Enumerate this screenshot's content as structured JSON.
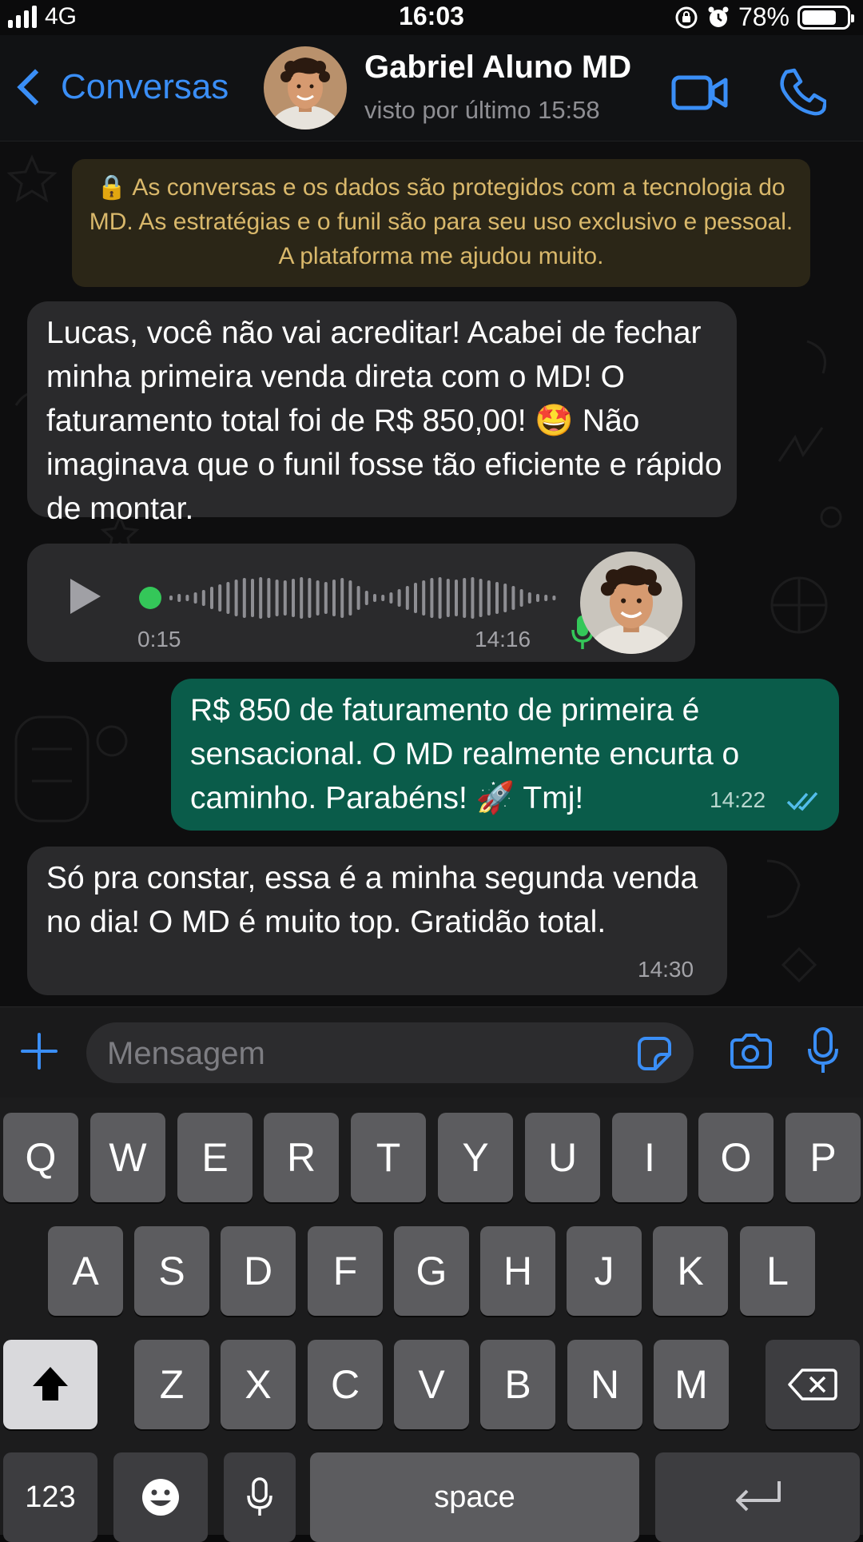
{
  "status_bar": {
    "network": "4G",
    "time": "16:03",
    "battery": "78%",
    "battery_level": 0.78,
    "icons": [
      "signal-icon",
      "orientation-lock-icon",
      "alarm-icon",
      "battery-icon"
    ]
  },
  "header": {
    "back_label": "Conversas",
    "contact_name": "Gabriel Aluno MD",
    "contact_status": "visto por último 15:58",
    "icons": [
      "chevron-left-icon",
      "avatar",
      "video-call-icon",
      "phone-icon"
    ]
  },
  "system_notice": {
    "lock_icon": "lock-icon",
    "text": "🔒 As conversas e os dados são protegidos com a tecnologia do MD. As estratégias e o funil são para seu uso exclusivo e pessoal. A plataforma me ajudou muito."
  },
  "messages": [
    {
      "direction": "in",
      "text": "Lucas, você não vai acreditar! Acabei de fechar minha primeira venda direta com o MD! O faturamento total foi de R$ 850,00! 🤩 Não imaginava que o funil fosse tão eficiente e rápido de montar."
    },
    {
      "direction": "in",
      "type": "audio",
      "duration": "0:15",
      "time": "14:16",
      "progress": 0
    },
    {
      "direction": "out",
      "text": "R$ 850 de faturamento de primeira é sensacional. O MD realmente encurta o caminho. Parabéns! 🚀 Tmj!",
      "time": "14:22",
      "status": "read"
    },
    {
      "direction": "in",
      "text": "Só pra constar, essa é a minha segunda venda no dia! O MD é muito top. Gratidão total.",
      "time": "14:30"
    }
  ],
  "input": {
    "placeholder": "Mensagem",
    "icons": [
      "plus-icon",
      "sticker-icon",
      "camera-icon",
      "microphone-icon"
    ]
  },
  "keyboard": {
    "row1": [
      "Q",
      "W",
      "E",
      "R",
      "T",
      "Y",
      "U",
      "I",
      "O",
      "P"
    ],
    "row2": [
      "A",
      "S",
      "D",
      "F",
      "G",
      "H",
      "J",
      "K",
      "L"
    ],
    "row3": [
      "Z",
      "X",
      "C",
      "V",
      "B",
      "N",
      "M"
    ],
    "numbers_label": "123",
    "space_label": "space"
  },
  "colors": {
    "accent_blue": "#3a8ef6",
    "incoming_bubble": "#2a2a2c",
    "outgoing_bubble": "#0a5c4a",
    "notice_bg": "#2b2617",
    "notice_text": "#d9b86b",
    "audio_green": "#34c759",
    "read_ticks": "#53bdeb"
  }
}
